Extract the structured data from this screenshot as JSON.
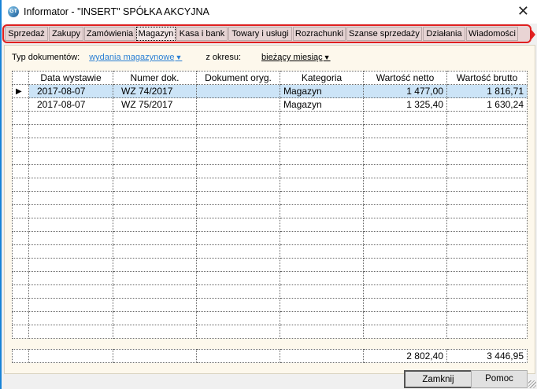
{
  "window": {
    "title": "Informator - \"INSERT\" SPÓŁKA AKCYJNA",
    "icon": "app-icon",
    "close": "✕"
  },
  "tabs": [
    {
      "label": "Sprzedaż"
    },
    {
      "label": "Zakupy"
    },
    {
      "label": "Zamówienia"
    },
    {
      "label": "Magazyn",
      "active": true
    },
    {
      "label": "Kasa i bank"
    },
    {
      "label": "Towary i usługi"
    },
    {
      "label": "Rozrachunki"
    },
    {
      "label": "Szanse sprzedaży"
    },
    {
      "label": "Działania"
    },
    {
      "label": "Wiadomości"
    }
  ],
  "filters": {
    "type_label": "Typ dokumentów:",
    "type_value": "wydania magazynowe",
    "period_label": "z okresu:",
    "period_value": "bieżący miesiąc"
  },
  "grid": {
    "columns": [
      "",
      "Data wystawie",
      "Numer dok.",
      "Dokument oryg.",
      "Kategoria",
      "Wartość netto",
      "Wartość brutto"
    ],
    "rows": [
      {
        "date": "2017-08-07",
        "number": "WZ 74/2017",
        "orig": "",
        "category": "Magazyn",
        "net": "1 477,00",
        "gross": "1 816,71",
        "selected": true
      },
      {
        "date": "2017-08-07",
        "number": "WZ 75/2017",
        "orig": "",
        "category": "Magazyn",
        "net": "1 325,40",
        "gross": "1 630,24"
      }
    ],
    "totals": {
      "net": "2 802,40",
      "gross": "3 446,95"
    }
  },
  "buttons": {
    "close": "Zamknij",
    "help": "Pomoc"
  },
  "colors": {
    "selected_row": "#cce4f7",
    "tab_highlight": "#e02020",
    "panel": "#fdf8ec",
    "link": "#2a7fd4"
  }
}
